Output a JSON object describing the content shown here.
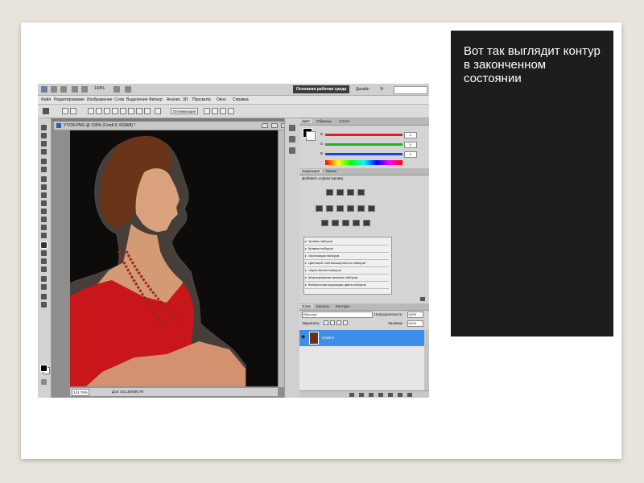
{
  "caption": {
    "text": "Вот так выглядит контур в законченном состоянии"
  },
  "photoshop": {
    "app_bar": {
      "zoom": "144%",
      "workspace": "Основная рабочая среда",
      "design": "Дизайн",
      "more": "»"
    },
    "menu": [
      "Файл",
      "Редактирование",
      "Изображение",
      "Слои",
      "Выделение",
      "Фильтр",
      "Анализ",
      "3D",
      "Просмотр",
      "Окно",
      "Справка"
    ],
    "options_bar": {
      "refine_button": "Оптимизация"
    },
    "document": {
      "title": "YYOR.PNG @ 100% (Слой 0, RGB/8) *",
      "zoom_field": "141,76%",
      "doc_size": "Док: 441,3К/606,7К"
    },
    "color_panel": {
      "tabs": [
        "Цвет",
        "Образцы",
        "Стили"
      ],
      "sliders": [
        {
          "label": "R",
          "value": "0",
          "color": "#e02020"
        },
        {
          "label": "G",
          "value": "0",
          "color": "#20b020"
        },
        {
          "label": "B",
          "value": "0",
          "color": "#2040e0"
        }
      ]
    },
    "adjustments_panel": {
      "tabs": [
        "Коррекция",
        "Маски"
      ],
      "title": "Добавить корректировку",
      "presets": [
        "Уровни наборов",
        "Кривые наборов",
        "Экспозиция наборов",
        "Цветовой тон/Насыщенность наборов",
        "Черно-белое наборов",
        "Микширование каналов наборов",
        "Выборочная коррекция цвета наборов"
      ]
    },
    "layers_panel": {
      "tabs": [
        "Слои",
        "Каналы",
        "Контуры"
      ],
      "blend_mode": "Обычные",
      "opacity_label": "Непрозрачность:",
      "opacity_value": "100%",
      "lock_label": "Закрепить:",
      "fill_label": "Заливка:",
      "fill_value": "100%",
      "layers": [
        {
          "name": "Слой 0",
          "selected": true
        }
      ]
    }
  }
}
